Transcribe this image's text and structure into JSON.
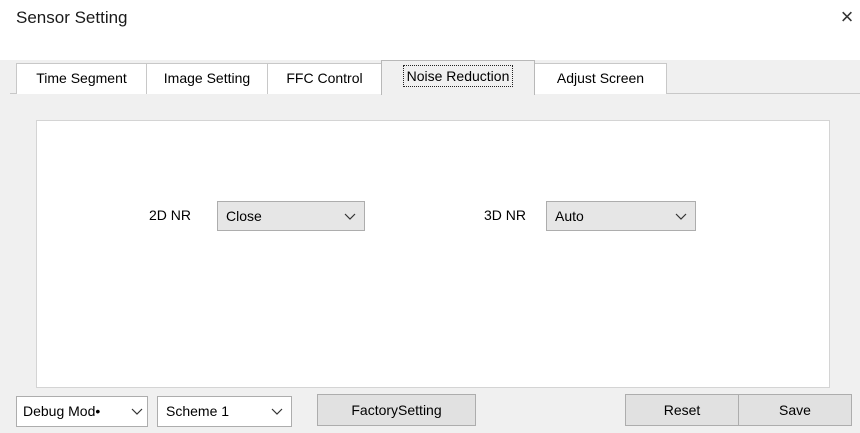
{
  "window": {
    "title": "Sensor Setting",
    "close_glyph": "×"
  },
  "tabs": [
    {
      "label": "Time Segment",
      "active": false
    },
    {
      "label": "Image Setting",
      "active": false
    },
    {
      "label": "FFC Control",
      "active": false
    },
    {
      "label": "Noise Reduction",
      "active": true
    },
    {
      "label": "Adjust Screen",
      "active": false
    }
  ],
  "noise_reduction": {
    "nr2d": {
      "label": "2D NR",
      "value": "Close"
    },
    "nr3d": {
      "label": "3D NR",
      "value": "Auto"
    }
  },
  "footer": {
    "mode_select": "Debug Mod•",
    "scheme_select": "Scheme 1",
    "factory_label": "FactorySetting",
    "reset_label": "Reset",
    "save_label": "Save"
  },
  "icons": {
    "close": "close-icon",
    "dropdown": "chevron-down-icon"
  }
}
